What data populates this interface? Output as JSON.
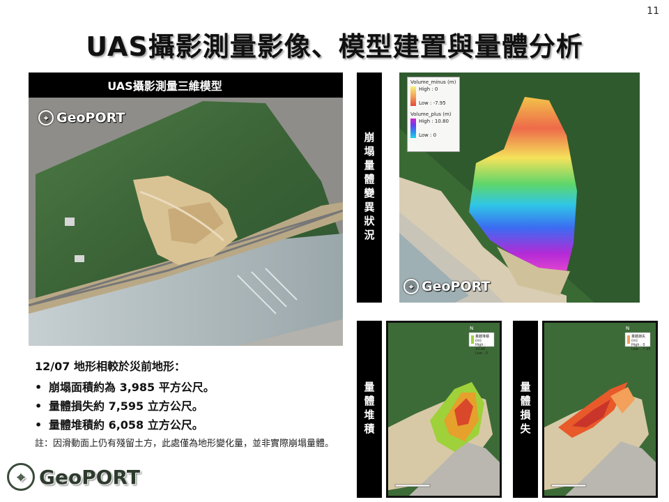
{
  "page_number": "11",
  "title": "UAS攝影測量影像、模型建置與量體分析",
  "model_panel": {
    "header": "UAS攝影測量三維模型",
    "logo_text": "GeoPORT"
  },
  "findings": {
    "heading": "12/07 地形相較於災前地形：",
    "items": [
      "崩塌面積約為 3,985 平方公尺。",
      "量體損失約 7,595 立方公尺。",
      "量體堆積約 6,058 立方公尺。"
    ],
    "bullet": "•",
    "note": "註：因滑動面上仍有殘留土方，此處僅為地形變化量，並非實際崩塌量體。"
  },
  "bottom_logo": "GeoPORT",
  "volume_change": {
    "label": "崩塌量體變異狀況",
    "logo_text": "GeoPORT",
    "legend": {
      "minus_title": "Volume_minus (m)",
      "minus_high": "High : 0",
      "minus_low": "Low : -7.95",
      "plus_title": "Volume_plus (m)",
      "plus_high": "High : 10.80",
      "plus_low": "Low : 0"
    }
  },
  "deposition": {
    "label": "量體堆積",
    "legend_title": "量體堆積 (m)",
    "legend_high": "High : 10.80",
    "legend_low": "Low : 0"
  },
  "loss": {
    "label": "量體損失",
    "legend_title": "量體損失 (m)",
    "legend_high": "High : 0",
    "legend_low": "Low : -7.95"
  },
  "colors": {
    "black": "#000000",
    "forest": "#3f6b3a",
    "river": "#b7c2c4",
    "soil": "#d8bf92",
    "minus_gradient": [
      "#f6f07a",
      "#f2a35a",
      "#e8463a"
    ],
    "plus_gradient": [
      "#d223c8",
      "#6a3cf0",
      "#2c8cf0",
      "#1fd6e8"
    ]
  }
}
